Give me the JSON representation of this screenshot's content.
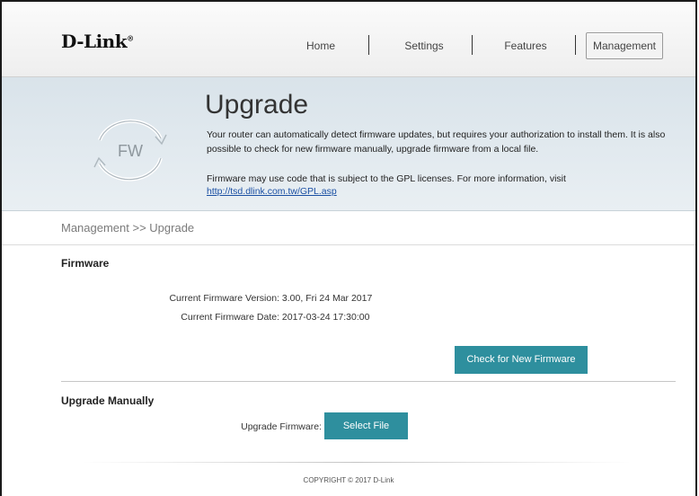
{
  "brand": {
    "logo_text": "D-Link",
    "registered_mark": "®"
  },
  "nav": {
    "items": [
      {
        "label": "Home"
      },
      {
        "label": "Settings"
      },
      {
        "label": "Features"
      },
      {
        "label": "Management"
      }
    ],
    "active": "Management"
  },
  "banner": {
    "title": "Upgrade",
    "icon_text": "FW",
    "description": "Your router can automatically detect firmware updates, but requires your authorization to install them. It is also possible to check for new firmware manually, upgrade firmware from a local file.",
    "gpl_text": "Firmware may use code that is subject to the GPL licenses. For more information, visit",
    "gpl_link": "http://tsd.dlink.com.tw/GPL.asp"
  },
  "breadcrumb": "Management >> Upgrade",
  "firmware": {
    "section_title": "Firmware",
    "version_label": "Current Firmware Version:",
    "version_value": "3.00, Fri 24 Mar 2017",
    "date_label": "Current Firmware Date:",
    "date_value": "2017-03-24 17:30:00",
    "check_button": "Check for New Firmware"
  },
  "manual": {
    "section_title": "Upgrade Manually",
    "upgrade_label": "Upgrade Firmware:",
    "select_button": "Select File"
  },
  "footer": {
    "copyright": "COPYRIGHT © 2017 D-Link"
  },
  "colors": {
    "accent": "#2e8f9e",
    "link": "#1a4fa3",
    "banner": "#dde6ec"
  }
}
